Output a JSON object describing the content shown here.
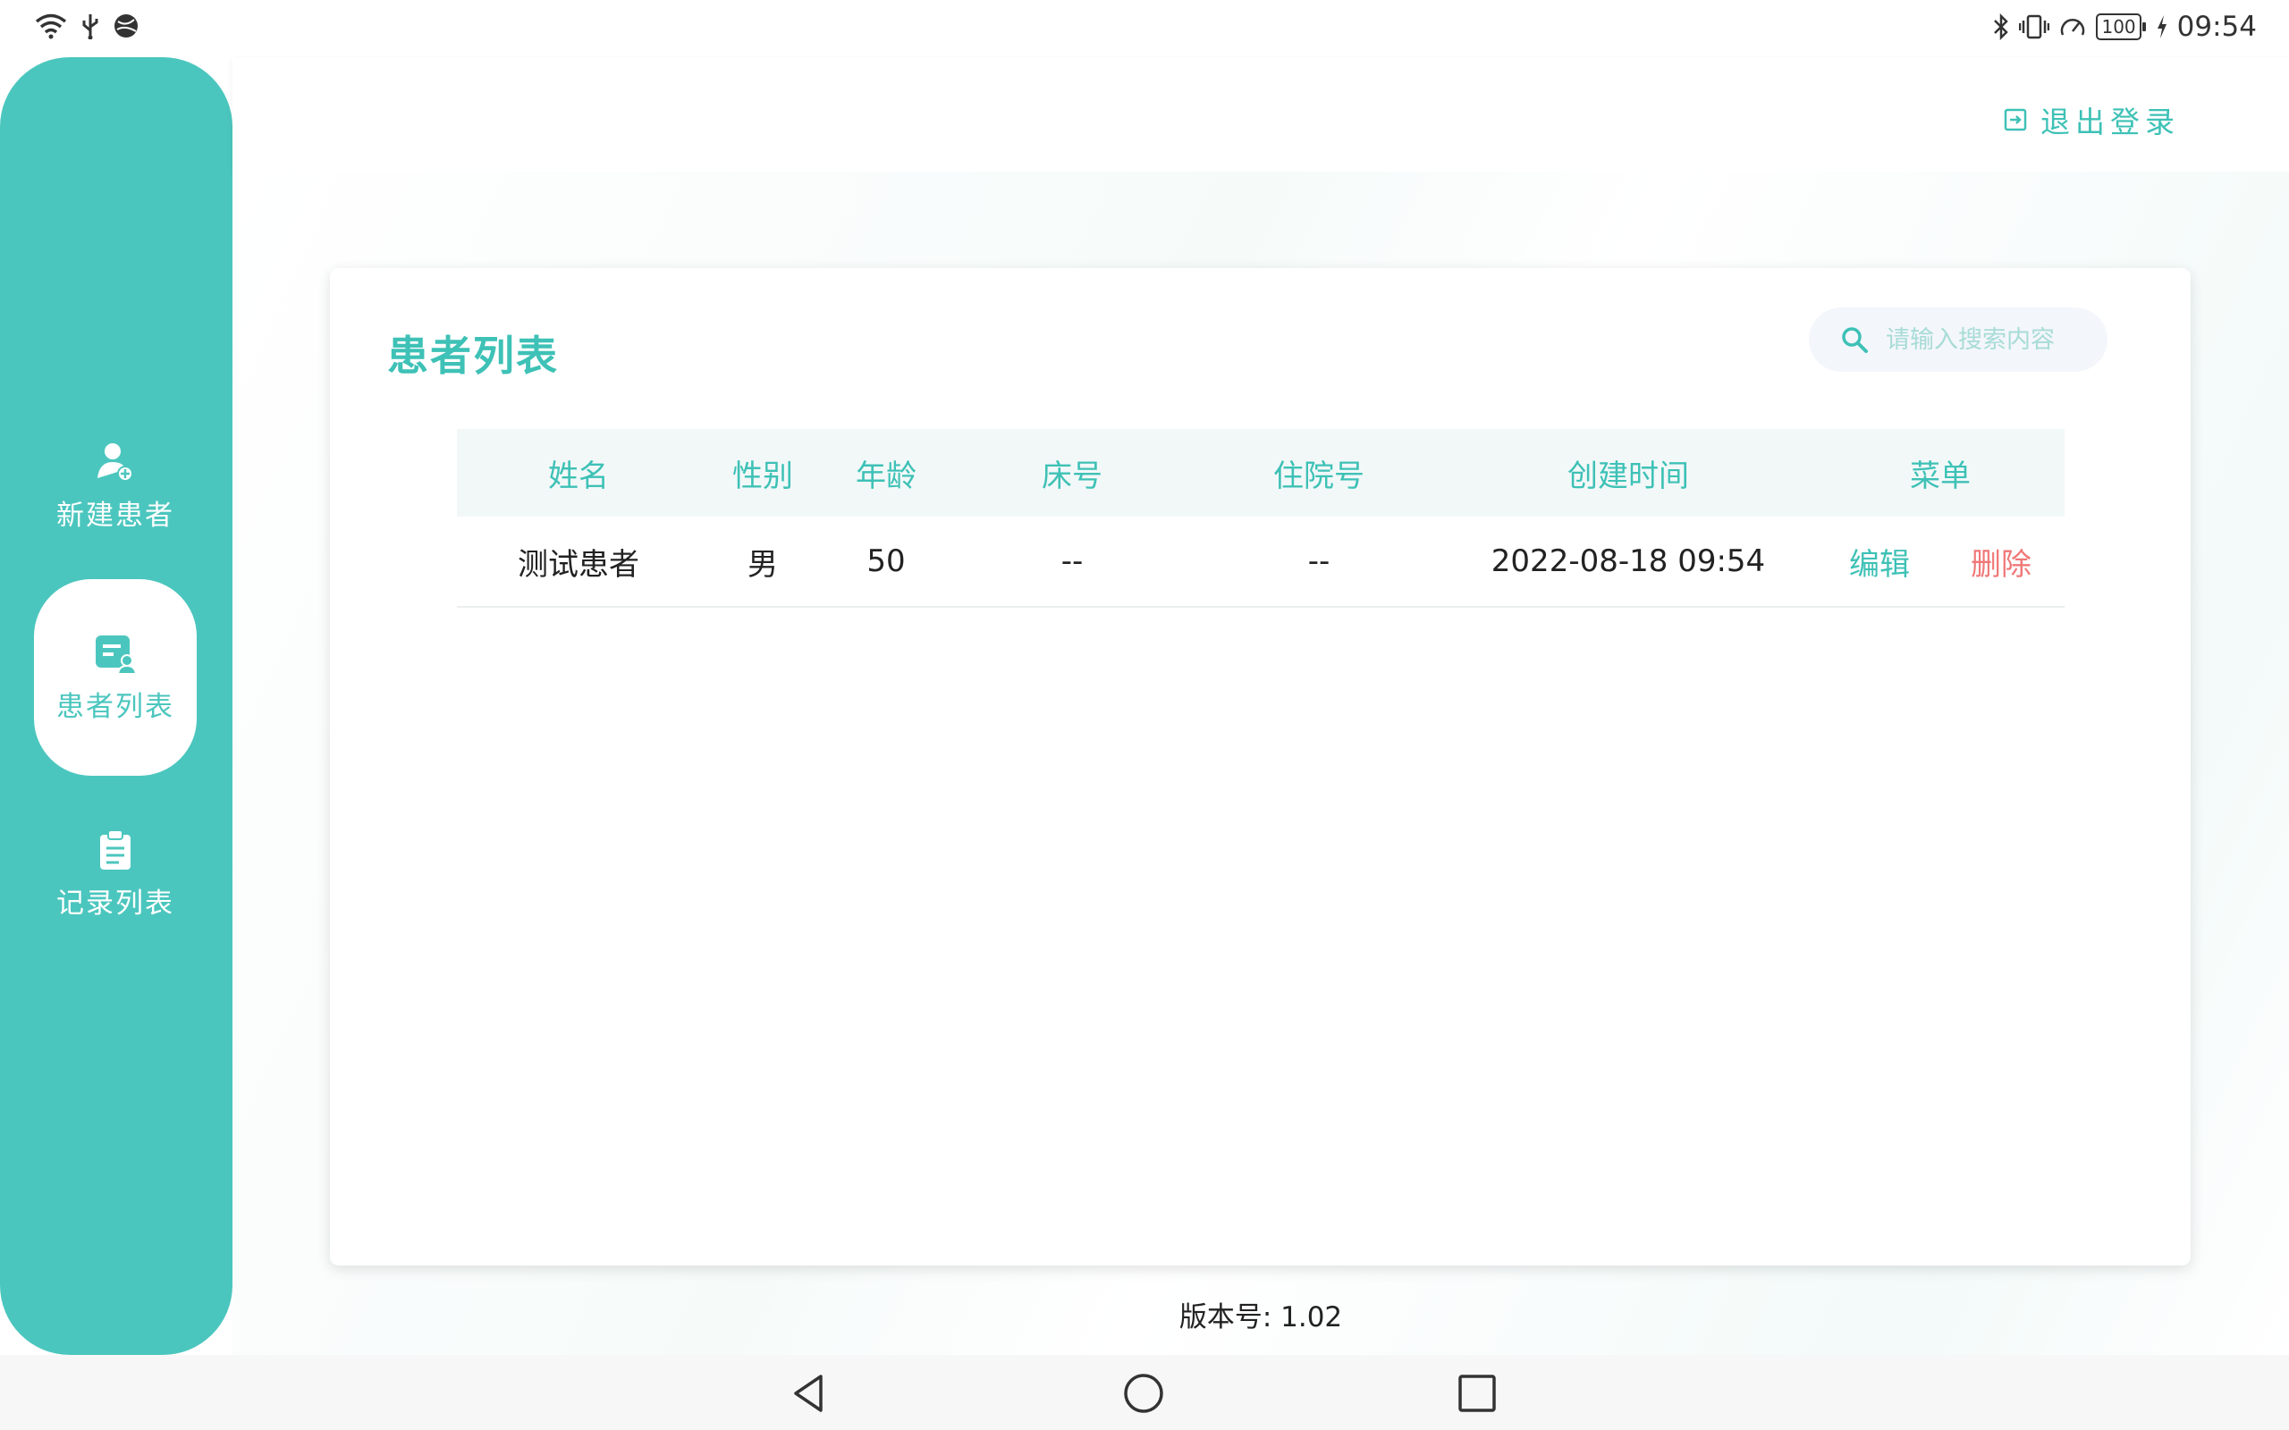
{
  "status_bar": {
    "time": "09:54",
    "battery": "100",
    "icons_left": [
      "wifi-icon",
      "usb-icon",
      "vpn-globe-icon"
    ],
    "icons_right": [
      "bluetooth-icon",
      "vibrate-icon",
      "speed-icon",
      "battery-icon",
      "charging-icon"
    ]
  },
  "sidebar": {
    "items": [
      {
        "label": "新建患者",
        "icon": "add-patient-icon",
        "active": false
      },
      {
        "label": "患者列表",
        "icon": "patient-list-icon",
        "active": true
      },
      {
        "label": "记录列表",
        "icon": "clipboard-icon",
        "active": false
      }
    ]
  },
  "header": {
    "logout_label": "退出登录"
  },
  "card": {
    "title": "患者列表",
    "search": {
      "placeholder": "请输入搜索内容",
      "value": ""
    }
  },
  "table": {
    "columns": [
      "姓名",
      "性别",
      "年龄",
      "床号",
      "住院号",
      "创建时间",
      "菜单"
    ],
    "rows": [
      {
        "name": "测试患者",
        "sex": "男",
        "age": "50",
        "bed": "--",
        "admission_no": "--",
        "created": "2022-08-18 09:54",
        "edit": "编辑",
        "delete": "删除"
      }
    ]
  },
  "version": "版本号: 1.02",
  "colors": {
    "accent": "#4bc6be",
    "accent_text": "#3ec1b6",
    "danger": "#f07878",
    "header_row": "#f2f8f8"
  }
}
